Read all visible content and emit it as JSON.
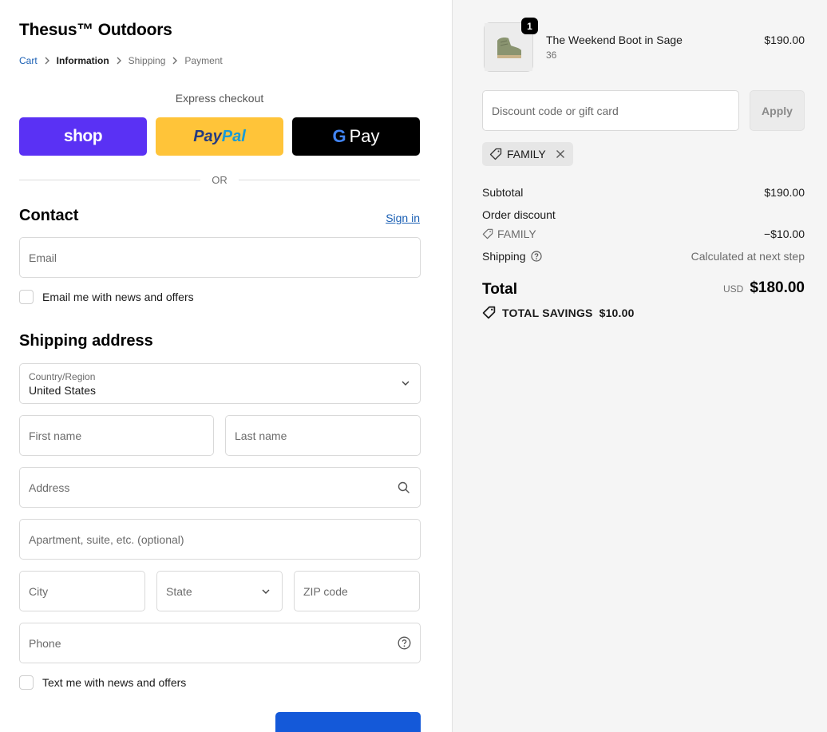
{
  "store": {
    "title": "Thesus™ Outdoors"
  },
  "breadcrumb": {
    "cart": "Cart",
    "information": "Information",
    "shipping": "Shipping",
    "payment": "Payment"
  },
  "express": {
    "label": "Express checkout",
    "shop": "shop",
    "paypal_1": "Pay",
    "paypal_2": "Pal",
    "gpay_g": "G",
    "gpay": "Pay",
    "or": "OR"
  },
  "contact": {
    "title": "Contact",
    "signin": "Sign in",
    "email_placeholder": "Email",
    "news_label": "Email me with news and offers"
  },
  "shipping_address": {
    "title": "Shipping address",
    "country_label": "Country/Region",
    "country_value": "United States",
    "first_name": "First name",
    "last_name": "Last name",
    "address": "Address",
    "apartment": "Apartment, suite, etc. (optional)",
    "city": "City",
    "state": "State",
    "zip": "ZIP code",
    "phone": "Phone",
    "text_news_label": "Text me with news and offers"
  },
  "order": {
    "product_name": "The Weekend Boot in Sage",
    "product_variant": "36",
    "product_price": "$190.00",
    "quantity": "1",
    "discount_placeholder": "Discount code or gift card",
    "apply": "Apply",
    "applied_code": "FAMILY",
    "subtotal_label": "Subtotal",
    "subtotal_value": "$190.00",
    "order_discount_label": "Order discount",
    "discount_code": "FAMILY",
    "discount_value": "−$10.00",
    "shipping_label": "Shipping",
    "shipping_value": "Calculated at next step",
    "total_label": "Total",
    "currency": "USD",
    "total_value": "$180.00",
    "savings_label": "TOTAL SAVINGS",
    "savings_value": "$10.00"
  },
  "colors": {
    "shop": "#5a31f4",
    "paypal": "#ffc439",
    "gpay": "#000000",
    "link": "#1a5fb4",
    "primary_button": "#1459d9"
  }
}
